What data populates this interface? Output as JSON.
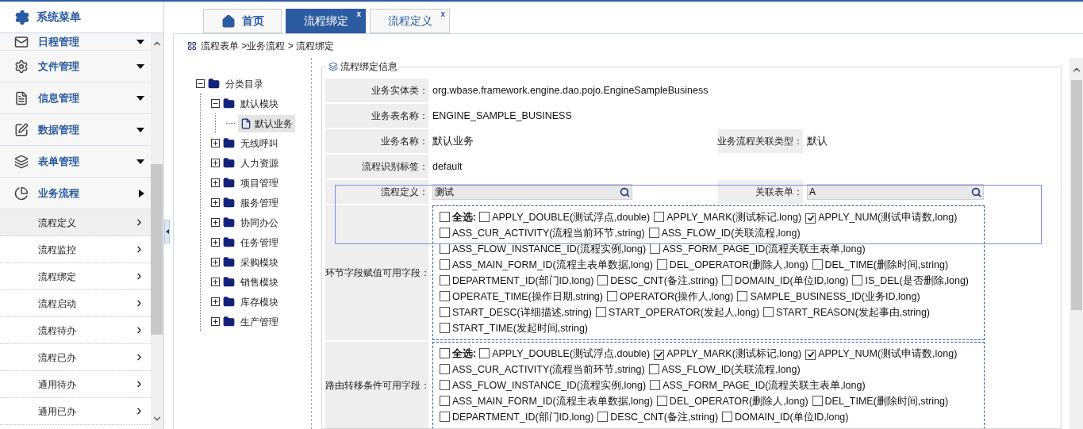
{
  "sidebar": {
    "title": "系统菜单",
    "items": [
      {
        "label": "日程管理",
        "expanded": false
      },
      {
        "label": "文件管理",
        "expanded": false
      },
      {
        "label": "信息管理",
        "expanded": false
      },
      {
        "label": "数据管理",
        "expanded": false
      },
      {
        "label": "表单管理",
        "expanded": false
      },
      {
        "label": "业务流程",
        "expanded": true,
        "children": [
          {
            "label": "流程定义",
            "selected": true
          },
          {
            "label": "流程监控",
            "selected": false
          },
          {
            "label": "流程绑定",
            "selected": false
          },
          {
            "label": "流程启动",
            "selected": false
          },
          {
            "label": "流程待办",
            "selected": false
          },
          {
            "label": "流程已办",
            "selected": false
          },
          {
            "label": "通用待办",
            "selected": false
          },
          {
            "label": "通用已办",
            "selected": false
          }
        ]
      }
    ]
  },
  "tabs": [
    {
      "label": "首页",
      "kind": "home",
      "selected": false
    },
    {
      "label": "流程绑定",
      "kind": "page",
      "close": "x",
      "selected": true
    },
    {
      "label": "流程定义",
      "kind": "page",
      "close": "x",
      "selected": false
    }
  ],
  "breadcrumb": "流程表单 >业务流程 > 流程绑定",
  "tree": {
    "label": "分类目录",
    "expanded": true,
    "children": [
      {
        "label": "默认模块",
        "expanded": true,
        "children": [
          {
            "label": "默认业务",
            "selected": true
          }
        ]
      },
      {
        "label": "无线呼叫",
        "expanded": false
      },
      {
        "label": "人力资源",
        "expanded": false
      },
      {
        "label": "项目管理",
        "expanded": false
      },
      {
        "label": "服务管理",
        "expanded": false
      },
      {
        "label": "协同办公",
        "expanded": false
      },
      {
        "label": "任务管理",
        "expanded": false
      },
      {
        "label": "采购模块",
        "expanded": false
      },
      {
        "label": "销售模块",
        "expanded": false
      },
      {
        "label": "库存模块",
        "expanded": false
      },
      {
        "label": "生产管理",
        "expanded": false
      }
    ]
  },
  "form": {
    "title": "流程绑定信息",
    "rows": [
      {
        "kind": "text",
        "cells": [
          {
            "label": "业务实体类：",
            "value": "org.wbase.framework.engine.dao.pojo.EngineSampleBusiness"
          }
        ]
      },
      {
        "kind": "text",
        "cells": [
          {
            "label": "业务表名称：",
            "value": "ENGINE_SAMPLE_BUSINESS"
          }
        ]
      },
      {
        "kind": "text",
        "cells": [
          {
            "label": "业务名称：",
            "value": "默认业务"
          },
          {
            "label": "业务流程关联类型：",
            "value": "默认"
          }
        ]
      },
      {
        "kind": "text",
        "cells": [
          {
            "label": "流程识别标签：",
            "value": "default"
          }
        ]
      },
      {
        "kind": "lookup",
        "cells": [
          {
            "label": "流程定义：",
            "value": "测试"
          },
          {
            "label": "关联表单：",
            "value": "A"
          }
        ]
      },
      {
        "kind": "checklist",
        "label": "环节字段赋值可用字段：",
        "select_all": {
          "label": "全选:",
          "checked": false
        },
        "options": [
          {
            "label": "APPLY_DOUBLE(测试浮点,double)",
            "checked": false
          },
          {
            "label": "APPLY_MARK(测试标记,long)",
            "checked": false
          },
          {
            "label": "APPLY_NUM(测试申请数,long)",
            "checked": true
          },
          {
            "label": "ASS_CUR_ACTIVITY(流程当前环节,string)",
            "checked": false
          },
          {
            "label": "ASS_FLOW_ID(关联流程,long)",
            "checked": false
          },
          {
            "label": "ASS_FLOW_INSTANCE_ID(流程实例,long)",
            "checked": false
          },
          {
            "label": "ASS_FORM_PAGE_ID(流程关联主表单,long)",
            "checked": false
          },
          {
            "label": "ASS_MAIN_FORM_ID(流程主表单数据,long)",
            "checked": false
          },
          {
            "label": "DEL_OPERATOR(删除人,long)",
            "checked": false
          },
          {
            "label": "DEL_TIME(删除时间,string)",
            "checked": false
          },
          {
            "label": "DEPARTMENT_ID(部门ID,long)",
            "checked": false
          },
          {
            "label": "DESC_CNT(备注,string)",
            "checked": false
          },
          {
            "label": "DOMAIN_ID(单位ID,long)",
            "checked": false
          },
          {
            "label": "IS_DEL(是否删除,long)",
            "checked": false
          },
          {
            "label": "OPERATE_TIME(操作日期,string)",
            "checked": false
          },
          {
            "label": "OPERATOR(操作人,long)",
            "checked": false
          },
          {
            "label": "SAMPLE_BUSINESS_ID(业务ID,long)",
            "checked": false
          },
          {
            "label": "START_DESC(详细描述,string)",
            "checked": false
          },
          {
            "label": "START_OPERATOR(发起人,long)",
            "checked": false
          },
          {
            "label": "START_REASON(发起事由,string)",
            "checked": false
          },
          {
            "label": "START_TIME(发起时间,string)",
            "checked": false
          }
        ]
      },
      {
        "kind": "checklist",
        "label": "路由转移条件可用字段：",
        "select_all": {
          "label": "全选:",
          "checked": false
        },
        "options": [
          {
            "label": "APPLY_DOUBLE(测试浮点,double)",
            "checked": false
          },
          {
            "label": "APPLY_MARK(测试标记,long)",
            "checked": true
          },
          {
            "label": "APPLY_NUM(测试申请数,long)",
            "checked": true
          },
          {
            "label": "ASS_CUR_ACTIVITY(流程当前环节,string)",
            "checked": false
          },
          {
            "label": "ASS_FLOW_ID(关联流程,long)",
            "checked": false
          },
          {
            "label": "ASS_FLOW_INSTANCE_ID(流程实例,long)",
            "checked": false
          },
          {
            "label": "ASS_FORM_PAGE_ID(流程关联主表单,long)",
            "checked": false
          },
          {
            "label": "ASS_MAIN_FORM_ID(流程主表单数据,long)",
            "checked": false
          },
          {
            "label": "DEL_OPERATOR(删除人,long)",
            "checked": false
          },
          {
            "label": "DEL_TIME(删除时间,string)",
            "checked": false
          },
          {
            "label": "DEPARTMENT_ID(部门ID,long)",
            "checked": false
          },
          {
            "label": "DESC_CNT(备注,string)",
            "checked": false
          },
          {
            "label": "DOMAIN_ID(单位ID,long)",
            "checked": false
          }
        ]
      }
    ]
  }
}
